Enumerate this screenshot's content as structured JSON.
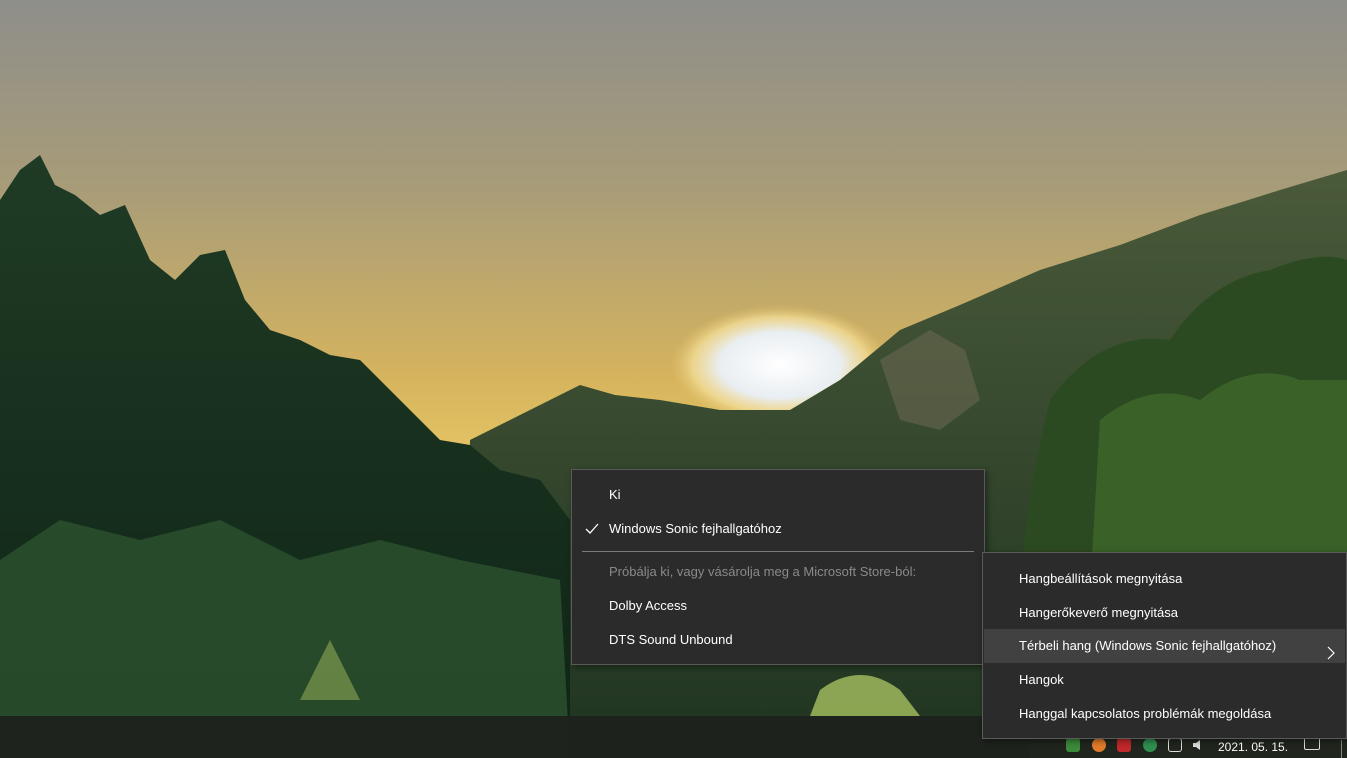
{
  "submenu": {
    "items": [
      {
        "label": "Ki",
        "checked": false,
        "disabled": false
      },
      {
        "label": "Windows Sonic fejhallgatóhoz",
        "checked": true,
        "disabled": false
      },
      {
        "label": "Próbálja ki, vagy vásárolja meg a Microsoft Store-ból:",
        "checked": false,
        "disabled": true
      },
      {
        "label": "Dolby Access",
        "checked": false,
        "disabled": false
      },
      {
        "label": "DTS Sound Unbound",
        "checked": false,
        "disabled": false
      }
    ]
  },
  "context_menu": {
    "items": [
      {
        "label": "Hangbeállítások megnyitása"
      },
      {
        "label": "Hangerőkeverő megnyitása"
      },
      {
        "label": "Térbeli hang (Windows Sonic fejhallgatóhoz)",
        "has_submenu": true,
        "highlighted": true
      },
      {
        "label": "Hangok"
      },
      {
        "label": "Hanggal kapcsolatos problémák megoldása"
      }
    ]
  },
  "taskbar": {
    "date": "2021. 05. 15.",
    "tray_icons": [
      "onedrive-icon",
      "firefox-icon",
      "antivirus-icon",
      "security-icon",
      "network-icon",
      "volume-icon"
    ]
  },
  "colors": {
    "menu_bg": "#2b2b2b",
    "menu_border": "#5a5a5a",
    "hover_bg": "#414141",
    "text": "#ffffff",
    "disabled_text": "#8a8a8a"
  }
}
